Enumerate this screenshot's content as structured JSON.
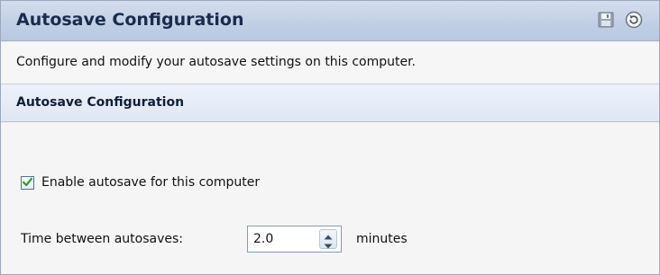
{
  "panel": {
    "title": "Autosave Configuration",
    "description": "Configure and modify your autosave settings on this computer.",
    "icons": {
      "save": "save-disk-icon",
      "reset": "reset-icon"
    }
  },
  "section": {
    "title": "Autosave Configuration"
  },
  "settings": {
    "enable_autosave": {
      "label": "Enable autosave for this computer",
      "checked": true
    },
    "interval": {
      "label": "Time between autosaves:",
      "value": "2.0",
      "unit": "minutes"
    }
  },
  "colors": {
    "title_bar": "#c2d0e6",
    "title_text": "#1a2b4c",
    "section_header": "#dfe7f4",
    "body_background": "#f5f5f5",
    "checkmark": "#2e9e2e"
  }
}
